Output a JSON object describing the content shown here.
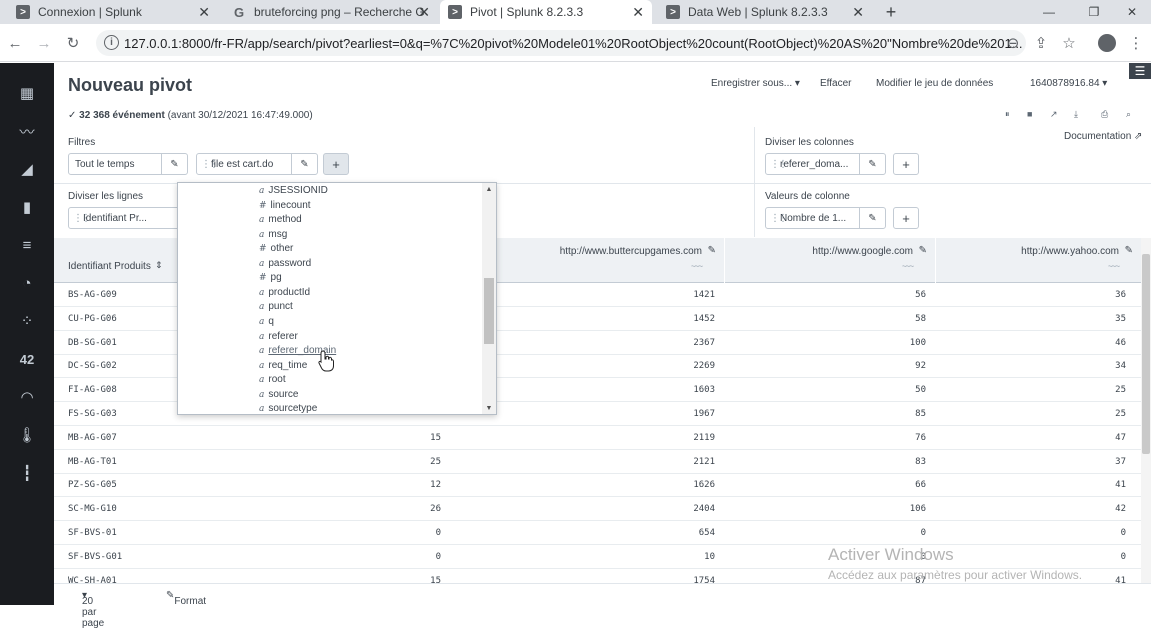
{
  "browser": {
    "tabs": [
      {
        "title": "Connexion | Splunk",
        "icon": "splunk-icon"
      },
      {
        "title": "bruteforcing png – Recherche Go",
        "icon": "google-icon"
      },
      {
        "title": "Pivot | Splunk 8.2.3.3",
        "icon": "splunk-icon",
        "active": true
      },
      {
        "title": "Data Web | Splunk 8.2.3.3",
        "icon": "splunk-icon"
      }
    ],
    "url": "127.0.0.1:8000/fr-FR/app/search/pivot?earliest=0&q=%7C%20pivot%20Modele01%20RootObject%20count(RootObject)%20AS%20\"Nombre%20de%201..."
  },
  "header": {
    "title": "Nouveau pivot",
    "save_as": "Enregistrer sous...",
    "clear": "Effacer",
    "modify_dataset": "Modifier le jeu de données",
    "job_id": "1640878916.84"
  },
  "events": {
    "count": "32 368 événement",
    "timestamp": "(avant 30/12/2021 16:47:49.000)"
  },
  "documentation": "Documentation",
  "filters": {
    "label": "Filtres",
    "time": "Tout le temps",
    "file": "file est cart.do"
  },
  "split_columns": {
    "label": "Diviser les colonnes",
    "value": "referer_doma..."
  },
  "split_rows": {
    "label": "Diviser les lignes",
    "value": "Identifiant Pr..."
  },
  "column_values": {
    "label": "Valeurs de colonne",
    "value": "Nombre de 1..."
  },
  "table": {
    "first_col": "Identifiant Produits",
    "columns": [
      {
        "name": "http://www.buttercupgames.com"
      },
      {
        "name": "http://www.google.com"
      },
      {
        "name": "http://www.yahoo.com"
      }
    ],
    "rows": [
      {
        "id": "BS-AG-G09",
        "hidden": "",
        "b": "1421",
        "g": "56",
        "y": "36"
      },
      {
        "id": "CU-PG-G06",
        "hidden": "",
        "b": "1452",
        "g": "58",
        "y": "35"
      },
      {
        "id": "DB-SG-G01",
        "hidden": "",
        "b": "2367",
        "g": "100",
        "y": "46"
      },
      {
        "id": "DC-SG-G02",
        "hidden": "",
        "b": "2269",
        "g": "92",
        "y": "34"
      },
      {
        "id": "FI-AG-G08",
        "hidden": "",
        "b": "1603",
        "g": "50",
        "y": "25"
      },
      {
        "id": "FS-SG-G03",
        "hidden": "",
        "b": "1967",
        "g": "85",
        "y": "25"
      },
      {
        "id": "MB-AG-G07",
        "hidden": "15",
        "b": "2119",
        "g": "76",
        "y": "47"
      },
      {
        "id": "MB-AG-T01",
        "hidden": "25",
        "b": "2121",
        "g": "83",
        "y": "37"
      },
      {
        "id": "PZ-SG-G05",
        "hidden": "12",
        "b": "1626",
        "g": "66",
        "y": "41"
      },
      {
        "id": "SC-MG-G10",
        "hidden": "26",
        "b": "2404",
        "g": "106",
        "y": "42"
      },
      {
        "id": "SF-BVS-01",
        "hidden": "0",
        "b": "654",
        "g": "0",
        "y": "0"
      },
      {
        "id": "SF-BVS-G01",
        "hidden": "0",
        "b": "10",
        "g": "0",
        "y": "0"
      },
      {
        "id": "WC-SH-A01",
        "hidden": "15",
        "b": "1754",
        "g": "87",
        "y": "41"
      }
    ]
  },
  "footer": {
    "per_page": "20 par page",
    "format": "Format"
  },
  "dropdown": {
    "items": [
      {
        "type": "a",
        "name": "JSESSIONID"
      },
      {
        "type": "#",
        "name": "linecount"
      },
      {
        "type": "a",
        "name": "method"
      },
      {
        "type": "a",
        "name": "msg"
      },
      {
        "type": "#",
        "name": "other"
      },
      {
        "type": "a",
        "name": "password"
      },
      {
        "type": "#",
        "name": "pg"
      },
      {
        "type": "a",
        "name": "productId"
      },
      {
        "type": "a",
        "name": "punct"
      },
      {
        "type": "a",
        "name": "q"
      },
      {
        "type": "a",
        "name": "referer"
      },
      {
        "type": "a",
        "name": "referer_domain",
        "hover": true
      },
      {
        "type": "a",
        "name": "req_time"
      },
      {
        "type": "a",
        "name": "root"
      },
      {
        "type": "a",
        "name": "source"
      },
      {
        "type": "a",
        "name": "sourcetype"
      }
    ]
  },
  "watermark": {
    "line1": "Activer Windows",
    "line2": "Accédez aux paramètres pour activer Windows."
  }
}
